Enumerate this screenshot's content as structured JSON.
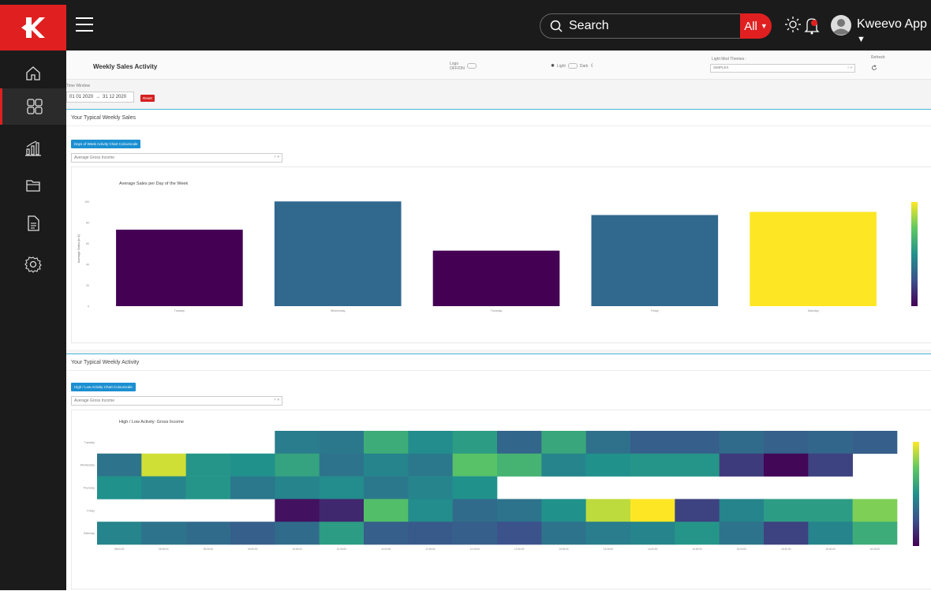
{
  "topbar": {
    "search_placeholder": "Search",
    "search_scope": "All",
    "app_name": "Kweevo App"
  },
  "sidebar": {
    "items": [
      "home-icon",
      "dashboard-icon",
      "analytics-icon",
      "folder-icon",
      "document-icon",
      "settings-icon"
    ],
    "active_index": 1
  },
  "header": {
    "title": "Weekly Sales Activity",
    "logo_label": "Logo",
    "logo_state": "OFF/ON",
    "theme_light": "Light",
    "theme_dark": "Dark",
    "themes_label": "Light Mod Themes :",
    "themes_value": "SIMPLEX",
    "refresh_label": "Refresh"
  },
  "time_window": {
    "label": "Time Window",
    "start": "01 01 2020",
    "end": "31 12 2020",
    "reset_label": "Reset"
  },
  "panels": {
    "weekly_sales": {
      "title": "Your Typical Weekly Sales",
      "button_label": "Days of Week Activity Chart Colourscale",
      "select_value": "Average Gross Income"
    },
    "weekly_activity": {
      "title": "Your Typical Weekly Activity",
      "button_label": "High / Low Activity Chart Colourscale",
      "select_value": "Average Gross Income"
    }
  },
  "chart_data": [
    {
      "type": "bar",
      "title": "Average Sales per Day of the Week",
      "ylabel": "Average Sales (in £)",
      "categories": [
        "Tuesday",
        "Wednesday",
        "Thursday",
        "Friday",
        "Saturday"
      ],
      "values": [
        73,
        100,
        53,
        87,
        90
      ],
      "ylim": [
        0,
        110
      ],
      "yticks": [
        0,
        20,
        40,
        60,
        80,
        100
      ],
      "colors": [
        "#440154",
        "#31688e",
        "#440154",
        "#31688e",
        "#fde725"
      ],
      "colorbar": true
    },
    {
      "type": "heatmap",
      "title": "High / Low Activity: Gross Income",
      "rows": [
        "Tuesday",
        "Wednesday",
        "Thursday",
        "Friday",
        "Saturday"
      ],
      "columns": [
        "08:00:00",
        "08:30:00",
        "09:00:00",
        "09:30:00",
        "10:00:00",
        "10:30:00",
        "11:00:00",
        "11:30:00",
        "12:00:00",
        "12:30:00",
        "13:00:00",
        "13:30:00",
        "14:00:00",
        "14:30:00",
        "15:00:00",
        "15:30:00",
        "16:00:00",
        "16:30:00"
      ],
      "values": [
        [
          null,
          null,
          null,
          null,
          0.42,
          0.4,
          0.62,
          0.48,
          0.55,
          0.33,
          0.6,
          0.37,
          0.3,
          0.3,
          0.35,
          0.31,
          0.33,
          0.3
        ],
        [
          0.38,
          0.93,
          0.52,
          0.5,
          0.58,
          0.38,
          0.45,
          0.4,
          0.72,
          0.65,
          0.45,
          0.5,
          0.52,
          0.52,
          0.18,
          0.02,
          0.2,
          null
        ],
        [
          0.5,
          0.45,
          0.52,
          0.4,
          0.45,
          0.48,
          0.4,
          0.45,
          0.5,
          null,
          null,
          null,
          null,
          null,
          null,
          null,
          null,
          null
        ],
        [
          null,
          null,
          null,
          null,
          0.05,
          0.12,
          0.7,
          0.48,
          0.35,
          0.38,
          0.5,
          0.9,
          1.0,
          0.2,
          0.45,
          0.55,
          0.55,
          0.8
        ],
        [
          0.45,
          0.38,
          0.35,
          0.3,
          0.35,
          0.55,
          0.3,
          0.28,
          0.3,
          0.25,
          0.38,
          0.42,
          0.45,
          0.52,
          0.38,
          0.2,
          0.45,
          0.62
        ]
      ],
      "colorbar": true
    }
  ]
}
